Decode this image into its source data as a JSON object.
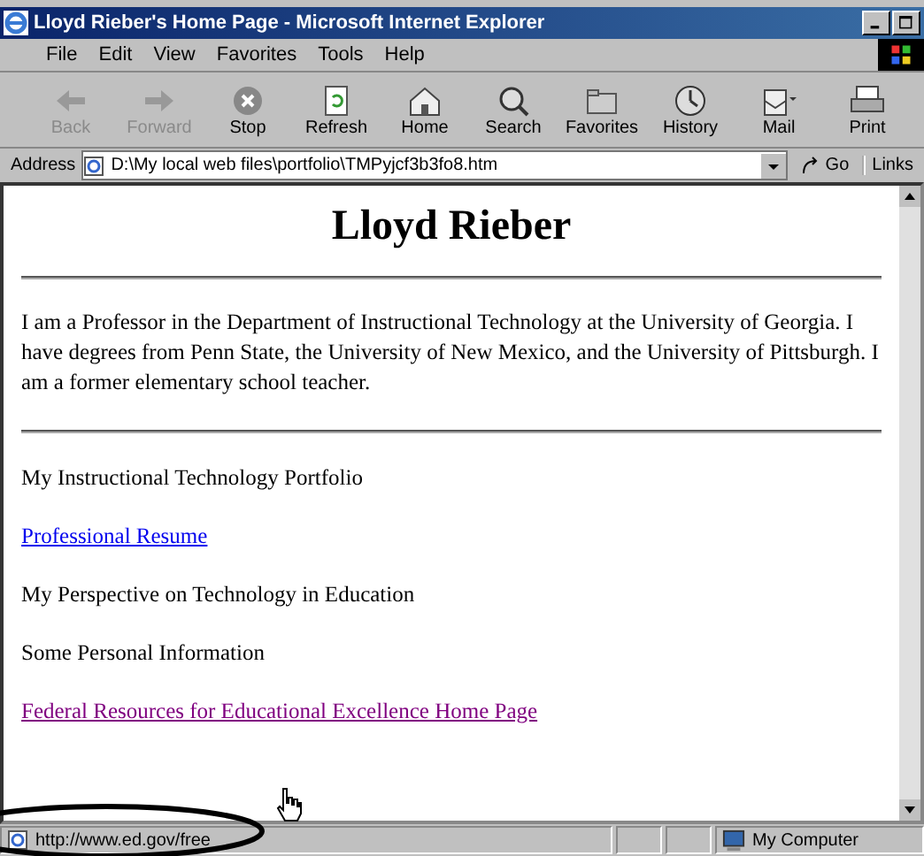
{
  "window": {
    "title": "Lloyd Rieber's Home Page - Microsoft Internet Explorer"
  },
  "menu": [
    "File",
    "Edit",
    "View",
    "Favorites",
    "Tools",
    "Help"
  ],
  "toolbar": [
    {
      "label": "Back",
      "kind": "back",
      "disabled": true
    },
    {
      "label": "Forward",
      "kind": "forward",
      "disabled": true
    },
    {
      "label": "Stop",
      "kind": "stop",
      "disabled": false
    },
    {
      "label": "Refresh",
      "kind": "refresh",
      "disabled": false
    },
    {
      "label": "Home",
      "kind": "home",
      "disabled": false
    },
    {
      "label": "Search",
      "kind": "search",
      "disabled": false
    },
    {
      "label": "Favorites",
      "kind": "favorites",
      "disabled": false
    },
    {
      "label": "History",
      "kind": "history",
      "disabled": false
    },
    {
      "label": "Mail",
      "kind": "mail",
      "disabled": false
    },
    {
      "label": "Print",
      "kind": "print",
      "disabled": false
    }
  ],
  "address_bar": {
    "label": "Address",
    "value": "D:\\My local web files\\portfolio\\TMPyjcf3b3fo8.htm",
    "go": "Go",
    "links": "Links"
  },
  "page": {
    "heading": "Lloyd Rieber",
    "intro": "I am a Professor in the Department of Instructional Technology at the University of Georgia. I have degrees from Penn State, the University of New Mexico, and the University of Pittsburgh. I am a former elementary school teacher.",
    "items": [
      {
        "text": "My Instructional Technology Portfolio",
        "kind": "text"
      },
      {
        "text": "Professional Resume",
        "kind": "link",
        "visited": false
      },
      {
        "text": "My Perspective on Technology in Education",
        "kind": "text"
      },
      {
        "text": "Some Personal Information",
        "kind": "text"
      },
      {
        "text": "Federal Resources for Educational Excellence Home Page",
        "kind": "link",
        "visited": true
      }
    ]
  },
  "status_bar": {
    "text": "http://www.ed.gov/free",
    "zone": "My Computer"
  }
}
